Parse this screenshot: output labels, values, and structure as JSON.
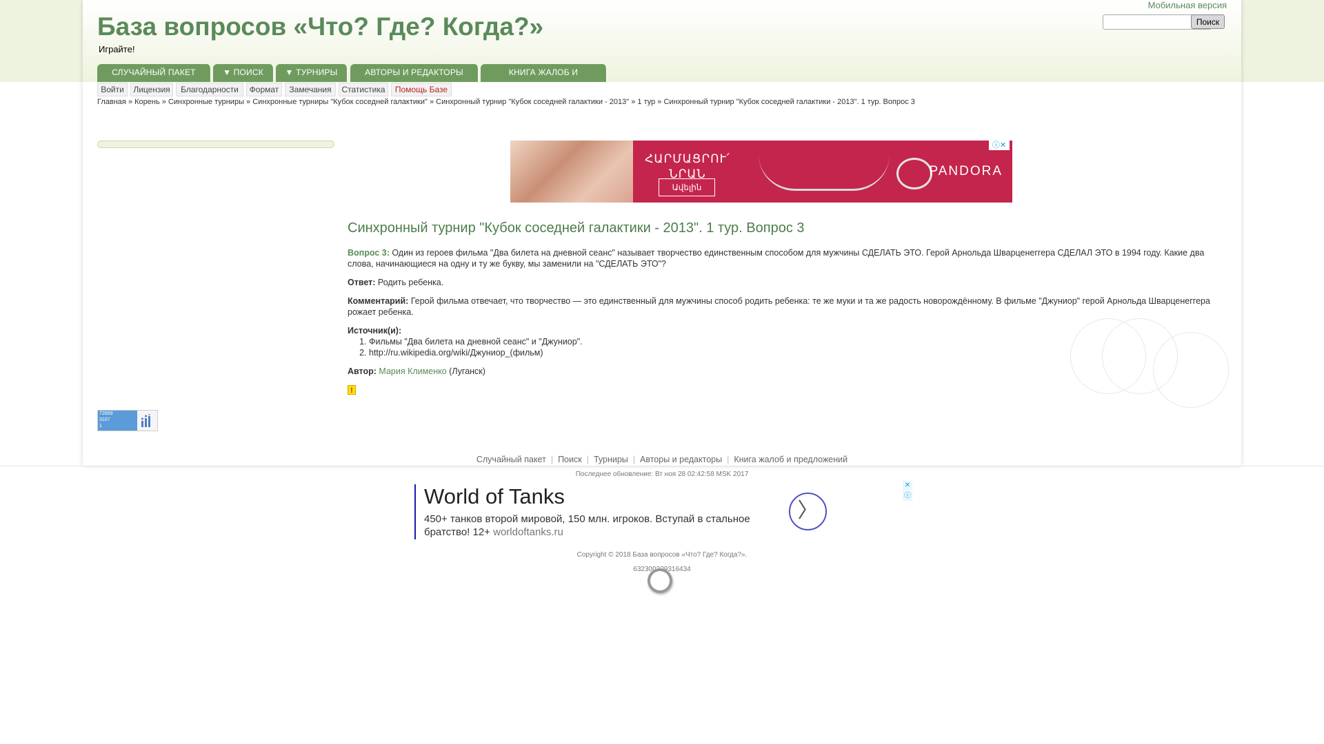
{
  "header": {
    "site_title": "База вопросов «Что? Где? Когда?»",
    "slogan": "Играйте!",
    "mobile_link": "Мобильная версия",
    "search_placeholder": "",
    "search_button": "Поиск"
  },
  "mainnav": [
    {
      "label": "СЛУЧАЙНЫЙ ПАКЕТ"
    },
    {
      "label": "▼  ПОИСК"
    },
    {
      "label": "▼  ТУРНИРЫ"
    },
    {
      "label": "АВТОРЫ И РЕДАКТОРЫ"
    },
    {
      "label": "КНИГА ЖАЛОБ И ПРЕДЛОЖЕНИЙ"
    }
  ],
  "subnav": [
    {
      "label": "Войти"
    },
    {
      "label": "Лицензия"
    },
    {
      "label": "Благодарности"
    },
    {
      "label": "Формат"
    },
    {
      "label": "Замечания"
    },
    {
      "label": "Статистика"
    },
    {
      "label": "Помощь Базе"
    }
  ],
  "breadcrumb": [
    {
      "label": "Главная"
    },
    {
      "label": "Корень"
    },
    {
      "label": "Синхронные турниры"
    },
    {
      "label": "Синхронные турниры \"Кубок соседней галактики\""
    },
    {
      "label": "Синхронный турнир \"Кубок соседней галактики - 2013\""
    },
    {
      "label": "1 тур"
    },
    {
      "label": "Синхронный турнир \"Кубок соседней галактики - 2013\". 1 тур. Вопрос 3"
    }
  ],
  "breadcrumb_sep": "»",
  "ad_top": {
    "text": "ՀԱՐՄԱՑՐՈՒ՛ ՆՐԱՆ",
    "cta": "Ավելին",
    "brand": "PANDORA",
    "close": "ⓘ✕"
  },
  "question": {
    "title": "Синхронный турнир \"Кубок соседней галактики - 2013\". 1 тур. Вопрос 3",
    "q_label": "Вопрос 3:",
    "q_text": "Один из героев фильма \"Два билета на дневной сеанс\" называет творчество единственным способом для мужчины СДЕЛАТЬ ЭТО. Герой Арнольда Шварценеггера СДЕЛАЛ ЭТО в 1994 году. Какие два слова, начинающиеся на одну и ту же букву, мы заменили на \"СДЕЛАТЬ ЭТО\"?",
    "answer_label": "Ответ:",
    "answer_text": "Родить ребенка.",
    "comment_label": "Комментарий:",
    "comment_text": "Герой фильма отвечает, что творчество — это единственный для мужчины способ родить ребенка: те же муки и та же радость новорождённому. В фильме \"Джуниор\" герой Арнольда Шварценеггера рожает ребенка.",
    "sources_label": "Источник(и):",
    "sources": [
      "Фильмы \"Два билета на дневной сеанс\" и \"Джуниор\".",
      "http://ru.wikipedia.org/wiki/Джуниор_(фильм)"
    ],
    "author_label": "Автор:",
    "author_name": "Мария Клименко",
    "author_city": "(Луганск)",
    "warn": "!"
  },
  "counter": {
    "line1": "72669",
    "line2": "3107",
    "line3": "1"
  },
  "footer": {
    "links": [
      {
        "label": "Случайный пакет"
      },
      {
        "label": "Поиск"
      },
      {
        "label": "Турниры"
      },
      {
        "label": "Авторы и редакторы"
      },
      {
        "label": "Книга жалоб и предложений"
      }
    ],
    "sep": "|",
    "last_update": "Последнее обновление: Вт ноя 28 02:42:58 MSK 2017",
    "copyright": "Copyright © 2018 База вопросов «Что? Где? Когда?».",
    "id_line": "632300229316434"
  },
  "ad_bottom": {
    "title": "World of Tanks",
    "desc": "450+ танков второй мировой, 150 млн. игроков. Вступай в стальное братство! 12+",
    "domain": "worldoftanks.ru",
    "arrow": "〉",
    "close": "✕",
    "info": "ⓘ"
  },
  "colors": {
    "accent_green": "#5a8a5a",
    "nav_green": "#6f9c5e",
    "header_bg": "#eef3de",
    "ad_red": "#c4254d"
  }
}
